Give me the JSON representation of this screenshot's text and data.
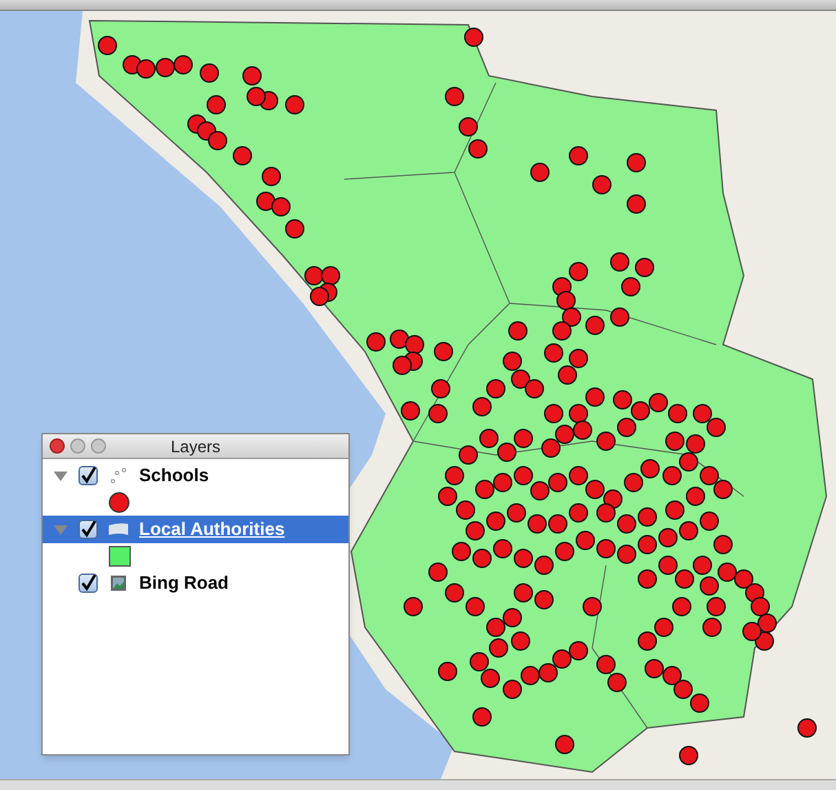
{
  "layers_panel": {
    "title": "Layers",
    "layers": [
      {
        "name": "Schools",
        "kind": "point",
        "checked": true,
        "expanded": true,
        "selected": false,
        "color": "#e8141b"
      },
      {
        "name": "Local Authorities",
        "kind": "polygon",
        "checked": true,
        "expanded": true,
        "selected": true,
        "color": "#55ee66"
      },
      {
        "name": "Bing Road",
        "kind": "raster",
        "checked": true,
        "selected": false
      }
    ]
  }
}
